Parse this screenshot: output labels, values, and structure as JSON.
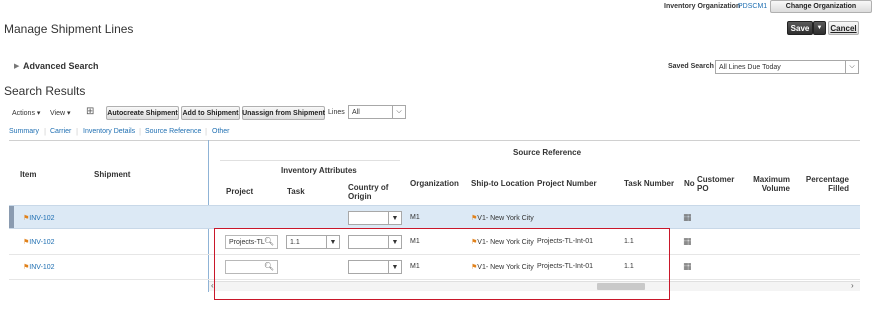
{
  "header": {
    "org_label": "Inventory Organization",
    "org_value": "PDSCM1",
    "change_org": "Change Organization"
  },
  "page": {
    "title": "Manage Shipment Lines",
    "save": "Save",
    "cancel": "Cancel"
  },
  "search": {
    "advanced": "Advanced Search",
    "saved_label": "Saved Search",
    "saved_value": "All Lines Due Today",
    "results_title": "Search Results"
  },
  "toolbar": {
    "actions": "Actions",
    "view": "View",
    "autocreate": "Autocreate Shipment",
    "add": "Add to Shipment",
    "unassign": "Unassign from Shipment",
    "lines_label": "Lines",
    "lines_value": "All"
  },
  "tabs": [
    "Summary",
    "Carrier",
    "Inventory Details",
    "Source Reference",
    "Other"
  ],
  "table": {
    "group_source": "Source Reference",
    "group_inventory": "Inventory Attributes",
    "col_item": "Item",
    "col_shipment": "Shipment",
    "col_project": "Project",
    "col_task": "Task",
    "col_country": "Country of Origin",
    "col_org": "Organization",
    "col_shipto": "Ship-to Location",
    "col_projnum": "Project Number",
    "col_tasknum": "Task Number",
    "col_no": "No",
    "col_custpo": "Customer PO",
    "col_maxvol": "Maximum Volume",
    "col_pct": "Percentage Filled",
    "rows": [
      {
        "item": "INV-102",
        "project": "",
        "task": "",
        "org": "M1",
        "shipto": "V1- New York City",
        "projnum": "",
        "tasknum": ""
      },
      {
        "item": "INV-102",
        "project": "Projects-TL",
        "task": "1.1",
        "org": "M1",
        "shipto": "V1- New York City",
        "projnum": "Projects-TL-Int-01",
        "tasknum": "1.1"
      },
      {
        "item": "INV-102",
        "project": "",
        "task": "",
        "org": "M1",
        "shipto": "V1- New York City",
        "projnum": "Projects-TL-Int-01",
        "tasknum": "1.1"
      }
    ]
  },
  "colors": {
    "highlight": "#c9172a",
    "link": "#1f6fb2",
    "selected_row": "#dce9f5"
  }
}
